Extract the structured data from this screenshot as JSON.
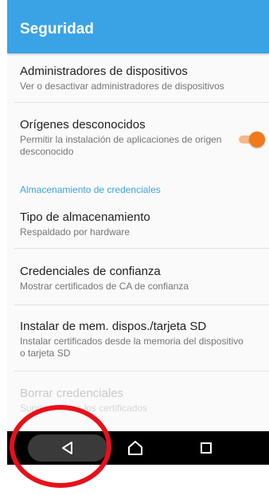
{
  "appbar": {
    "title": "Seguridad"
  },
  "items": [
    {
      "title": "Administradores de dispositivos",
      "subtitle": "Ver o desactivar administradores de dispositivos"
    },
    {
      "title": "Orígenes desconocidos",
      "subtitle": "Permitir la instalación de aplicaciones de origen desconocido",
      "toggle_on": true
    },
    {
      "title": "Tipo de almacenamiento",
      "subtitle": "Respaldado por hardware"
    },
    {
      "title": "Credenciales de confianza",
      "subtitle": "Mostrar certificados de CA de confianza"
    },
    {
      "title": "Instalar de mem. dispos./tarjeta SD",
      "subtitle": "Instalar certificados desde la memoria del dispositivo o tarjeta SD"
    },
    {
      "title": "Borrar credenciales",
      "subtitle": "Suprimir todos los certificados",
      "disabled": true
    }
  ],
  "section": {
    "credentials_header": "Almacenamiento de credenciales"
  },
  "navbar": {
    "buttons": [
      "back-icon",
      "home-icon",
      "recents-icon"
    ]
  },
  "colors": {
    "appbar": "#3aa3e6",
    "accent": "#3aa3e6",
    "toggle_on": "#f07a1a",
    "annotation": "#e8101a"
  }
}
